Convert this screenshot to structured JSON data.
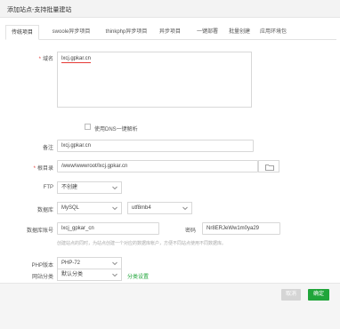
{
  "dialog": {
    "title": "添加站点-支持批量建站"
  },
  "tabs": [
    {
      "label": "传统项目"
    },
    {
      "label": "swoole异步项目"
    },
    {
      "label": "thinkphp异步项目"
    },
    {
      "label": "异步项目"
    },
    {
      "label": "一键部署"
    },
    {
      "label": "批量创建"
    },
    {
      "label": "应用环境包"
    }
  ],
  "form": {
    "domain": {
      "label": "域名",
      "value": "lxcj.gpkar.cn"
    },
    "dns": {
      "label": "使用DNS一键解析"
    },
    "remark": {
      "label": "备注",
      "value": "lxcj.gpkar.cn"
    },
    "root": {
      "label": "根目录",
      "value": "/www/wwwroot/lxcj.gpkar.cn"
    },
    "ftp": {
      "label": "FTP",
      "value": "不创建"
    },
    "database": {
      "label": "数据库",
      "type": "MySQL",
      "charset": "utf8mb4"
    },
    "db_account": {
      "label": "数据库账号",
      "value": "lxcj_gpkar_cn",
      "password_label": "密码",
      "password": "Nr8ERJeWw1m0ya29"
    },
    "db_hint": "创建站点的同时，为站点创建一个对应的数据库帐户，方便不同站点使用不同数据库。",
    "php": {
      "label": "PHP版本",
      "value": "PHP-72"
    },
    "category": {
      "label": "网站分类",
      "value": "默认分类",
      "link": "分类设置"
    }
  },
  "footer": {
    "cancel_label": "取消",
    "ok_label": "确定"
  },
  "colors": {
    "accent": "#20a53a",
    "required": "#e53935"
  }
}
